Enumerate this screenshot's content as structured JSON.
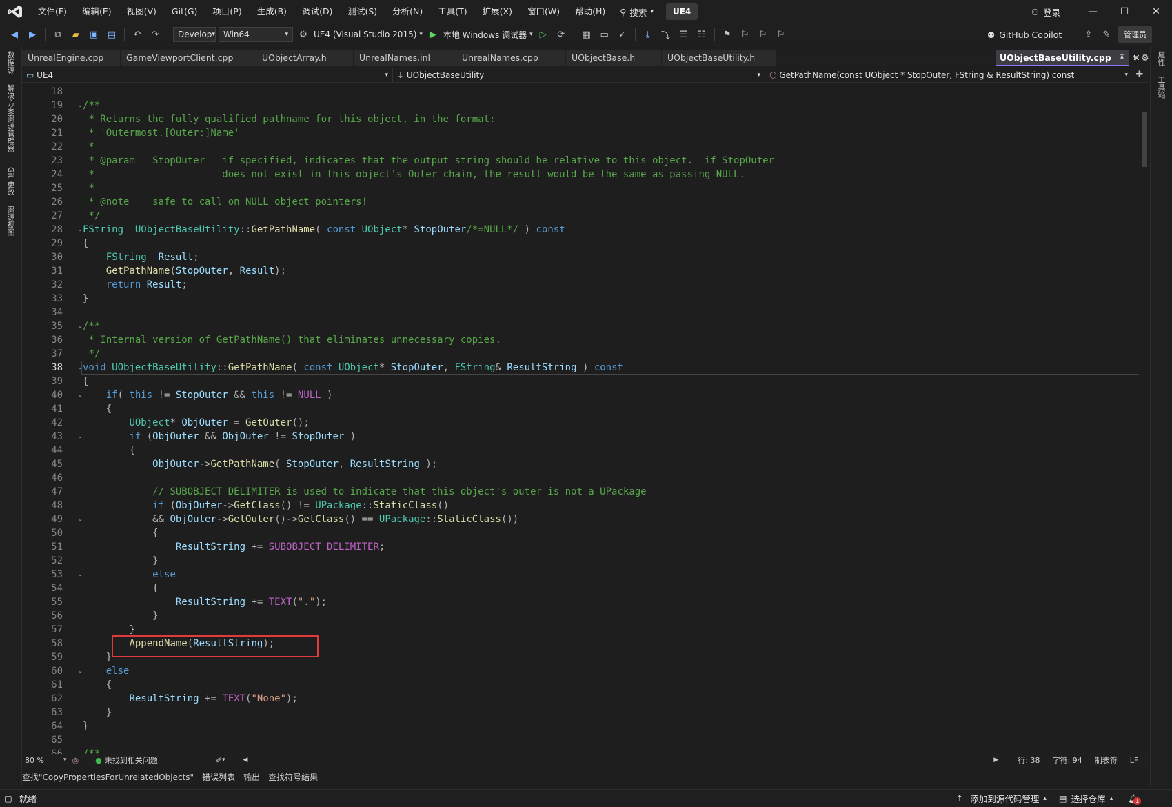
{
  "menubar": {
    "items": [
      "文件(F)",
      "编辑(E)",
      "视图(V)",
      "Git(G)",
      "项目(P)",
      "生成(B)",
      "调试(D)",
      "测试(S)",
      "分析(N)",
      "工具(T)",
      "扩展(X)",
      "窗口(W)",
      "帮助(H)"
    ],
    "search_label": "搜索",
    "solution_name": "UE4",
    "login_label": "登录"
  },
  "toolbar": {
    "config": "Develop",
    "platform": "Win64",
    "project": "UE4 (Visual Studio 2015)",
    "debugger": "本地 Windows 调试器",
    "copilot": "GitHub Copilot",
    "admin": "管理员"
  },
  "left_strip": [
    "数据源",
    "解决方案资源管理器",
    "Git 更改",
    "资源视图"
  ],
  "right_strip": [
    "属性",
    "工具箱"
  ],
  "tabs": [
    "UnrealEngine.cpp",
    "GameViewportClient.cpp",
    "UObjectArray.h",
    "UnrealNames.inl",
    "UnrealNames.cpp",
    "UObjectBase.h",
    "UObjectBaseUtility.h"
  ],
  "active_tab": "UObjectBaseUtility.cpp",
  "navbar": {
    "project": "UE4",
    "scope": "UObjectBaseUtility",
    "member": "GetPathName(const UObject * StopOuter, FString & ResultString) const"
  },
  "editor": {
    "first_line": 18,
    "current_line": 38,
    "lines": [
      [],
      [
        [
          "c",
          "/**"
        ]
      ],
      [
        [
          "c",
          " * Returns the fully qualified pathname for this object, in the format:"
        ]
      ],
      [
        [
          "c",
          " * 'Outermost.[Outer:]Name'"
        ]
      ],
      [
        [
          "c",
          " *"
        ]
      ],
      [
        [
          "c",
          " * @param   StopOuter   if specified, indicates that the output string should be relative to this object.  if StopOuter"
        ]
      ],
      [
        [
          "c",
          " *                      does not exist in this object's Outer chain, the result would be the same as passing NULL."
        ]
      ],
      [
        [
          "c",
          " *"
        ]
      ],
      [
        [
          "c",
          " * @note    safe to call on NULL object pointers!"
        ]
      ],
      [
        [
          "c",
          " */"
        ]
      ],
      [
        [
          "t",
          "FString"
        ],
        [
          "",
          "  "
        ],
        [
          "t",
          "UObjectBaseUtility"
        ],
        [
          "p",
          "::"
        ],
        [
          "f",
          "GetPathName"
        ],
        [
          "p",
          "( "
        ],
        [
          "k",
          "const"
        ],
        [
          "",
          "",
          " "
        ],
        [
          "t",
          "UObject"
        ],
        [
          "p",
          "* "
        ],
        [
          "v",
          "StopOuter"
        ],
        [
          "c",
          "/*=NULL*/"
        ],
        [
          "p",
          " ) "
        ],
        [
          "k",
          "const"
        ]
      ],
      [
        [
          "p",
          "{"
        ]
      ],
      [
        [
          "",
          "    "
        ],
        [
          "t",
          "FString"
        ],
        [
          "",
          "  "
        ],
        [
          "v",
          "Result"
        ],
        [
          "p",
          ";"
        ]
      ],
      [
        [
          "",
          "    "
        ],
        [
          "f",
          "GetPathName"
        ],
        [
          "p",
          "("
        ],
        [
          "v",
          "StopOuter"
        ],
        [
          "p",
          ", "
        ],
        [
          "v",
          "Result"
        ],
        [
          "p",
          ");"
        ]
      ],
      [
        [
          "",
          "    "
        ],
        [
          "k",
          "return"
        ],
        [
          "",
          "",
          " "
        ],
        [
          "v",
          "Result"
        ],
        [
          "p",
          ";"
        ]
      ],
      [
        [
          "p",
          "}"
        ]
      ],
      [],
      [
        [
          "c",
          "/**"
        ]
      ],
      [
        [
          "c",
          " * Internal version of GetPathName() that eliminates unnecessary copies."
        ]
      ],
      [
        [
          "c",
          " */"
        ]
      ],
      [
        [
          "k",
          "void"
        ],
        [
          "",
          "",
          " "
        ],
        [
          "t",
          "UObjectBaseUtility"
        ],
        [
          "p",
          "::"
        ],
        [
          "f",
          "GetPathName"
        ],
        [
          "p",
          "( "
        ],
        [
          "k",
          "const"
        ],
        [
          "",
          "",
          " "
        ],
        [
          "t",
          "UObject"
        ],
        [
          "p",
          "* "
        ],
        [
          "v",
          "StopOuter"
        ],
        [
          "p",
          ", "
        ],
        [
          "t",
          "FString"
        ],
        [
          "p",
          "& "
        ],
        [
          "v",
          "ResultString"
        ],
        [
          "p",
          " ) "
        ],
        [
          "k",
          "const"
        ]
      ],
      [
        [
          "p",
          "{"
        ]
      ],
      [
        [
          "",
          "    "
        ],
        [
          "k",
          "if"
        ],
        [
          "p",
          "( "
        ],
        [
          "k",
          "this"
        ],
        [
          "p",
          " != "
        ],
        [
          "v",
          "StopOuter"
        ],
        [
          "p",
          " && "
        ],
        [
          "k",
          "this"
        ],
        [
          "p",
          " != "
        ],
        [
          "m",
          "NULL"
        ],
        [
          "p",
          " )"
        ]
      ],
      [
        [
          "",
          "    "
        ],
        [
          "p",
          "{"
        ]
      ],
      [
        [
          "",
          "        "
        ],
        [
          "t",
          "UObject"
        ],
        [
          "p",
          "* "
        ],
        [
          "v",
          "ObjOuter"
        ],
        [
          "p",
          " = "
        ],
        [
          "f",
          "GetOuter"
        ],
        [
          "p",
          "();"
        ]
      ],
      [
        [
          "",
          "        "
        ],
        [
          "k",
          "if"
        ],
        [
          "p",
          " ("
        ],
        [
          "v",
          "ObjOuter"
        ],
        [
          "p",
          " && "
        ],
        [
          "v",
          "ObjOuter"
        ],
        [
          "p",
          " != "
        ],
        [
          "v",
          "StopOuter"
        ],
        [
          "p",
          " )"
        ]
      ],
      [
        [
          "",
          "        "
        ],
        [
          "p",
          "{"
        ]
      ],
      [
        [
          "",
          "            "
        ],
        [
          "v",
          "ObjOuter"
        ],
        [
          "p",
          "->"
        ],
        [
          "f",
          "GetPathName"
        ],
        [
          "p",
          "( "
        ],
        [
          "v",
          "StopOuter"
        ],
        [
          "p",
          ", "
        ],
        [
          "v",
          "ResultString"
        ],
        [
          "p",
          " );"
        ]
      ],
      [],
      [
        [
          "",
          "            "
        ],
        [
          "c",
          "// SUBOBJECT_DELIMITER is used to indicate that this object's outer is not a UPackage"
        ]
      ],
      [
        [
          "",
          "            "
        ],
        [
          "k",
          "if"
        ],
        [
          "p",
          " ("
        ],
        [
          "v",
          "ObjOuter"
        ],
        [
          "p",
          "->"
        ],
        [
          "f",
          "GetClass"
        ],
        [
          "p",
          "() != "
        ],
        [
          "t",
          "UPackage"
        ],
        [
          "p",
          "::"
        ],
        [
          "f",
          "StaticClass"
        ],
        [
          "p",
          "()"
        ]
      ],
      [
        [
          "",
          "            "
        ],
        [
          "p",
          "&& "
        ],
        [
          "v",
          "ObjOuter"
        ],
        [
          "p",
          "->"
        ],
        [
          "f",
          "GetOuter"
        ],
        [
          "p",
          "()->"
        ],
        [
          "f",
          "GetClass"
        ],
        [
          "p",
          "() == "
        ],
        [
          "t",
          "UPackage"
        ],
        [
          "p",
          "::"
        ],
        [
          "f",
          "StaticClass"
        ],
        [
          "p",
          "())"
        ]
      ],
      [
        [
          "",
          "            "
        ],
        [
          "p",
          "{"
        ]
      ],
      [
        [
          "",
          "                "
        ],
        [
          "v",
          "ResultString"
        ],
        [
          "p",
          " += "
        ],
        [
          "m",
          "SUBOBJECT_DELIMITER"
        ],
        [
          "p",
          ";"
        ]
      ],
      [
        [
          "",
          "            "
        ],
        [
          "p",
          "}"
        ]
      ],
      [
        [
          "",
          "            "
        ],
        [
          "k",
          "else"
        ]
      ],
      [
        [
          "",
          "            "
        ],
        [
          "p",
          "{"
        ]
      ],
      [
        [
          "",
          "                "
        ],
        [
          "v",
          "ResultString"
        ],
        [
          "p",
          " += "
        ],
        [
          "m",
          "TEXT"
        ],
        [
          "p",
          "("
        ],
        [
          "s",
          "\".\""
        ],
        [
          "p",
          ");"
        ]
      ],
      [
        [
          "",
          "            "
        ],
        [
          "p",
          "}"
        ]
      ],
      [
        [
          "",
          "        "
        ],
        [
          "p",
          "}"
        ]
      ],
      [
        [
          "",
          "        "
        ],
        [
          "f",
          "AppendName"
        ],
        [
          "p",
          "("
        ],
        [
          "v",
          "ResultString"
        ],
        [
          "p",
          ");"
        ]
      ],
      [
        [
          "",
          "    "
        ],
        [
          "p",
          "}"
        ]
      ],
      [
        [
          "",
          "    "
        ],
        [
          "k",
          "else"
        ]
      ],
      [
        [
          "",
          "    "
        ],
        [
          "p",
          "{"
        ]
      ],
      [
        [
          "",
          "        "
        ],
        [
          "v",
          "ResultString"
        ],
        [
          "p",
          " += "
        ],
        [
          "m",
          "TEXT"
        ],
        [
          "p",
          "("
        ],
        [
          "s",
          "\"None\""
        ],
        [
          "p",
          ");"
        ]
      ],
      [
        [
          "",
          "    "
        ],
        [
          "p",
          "}"
        ]
      ],
      [
        [
          "p",
          "}"
        ]
      ],
      [],
      [
        [
          "c",
          "/**"
        ]
      ]
    ],
    "folds": [
      19,
      28,
      35,
      38,
      40,
      43,
      49,
      53,
      60
    ]
  },
  "editor_status": {
    "zoom": "80 %",
    "issues": "未找到相关问题",
    "line": "行: 38",
    "char": "字符: 94",
    "indent": "制表符",
    "eol": "LF"
  },
  "output_tabs": [
    "查找\"CopyPropertiesForUnrelatedObjects\"",
    "错误列表",
    "输出",
    "查找符号结果"
  ],
  "statusbar": {
    "ready": "就绪",
    "source_control": "添加到源代码管理",
    "repo": "选择仓库",
    "notifications": "1"
  }
}
